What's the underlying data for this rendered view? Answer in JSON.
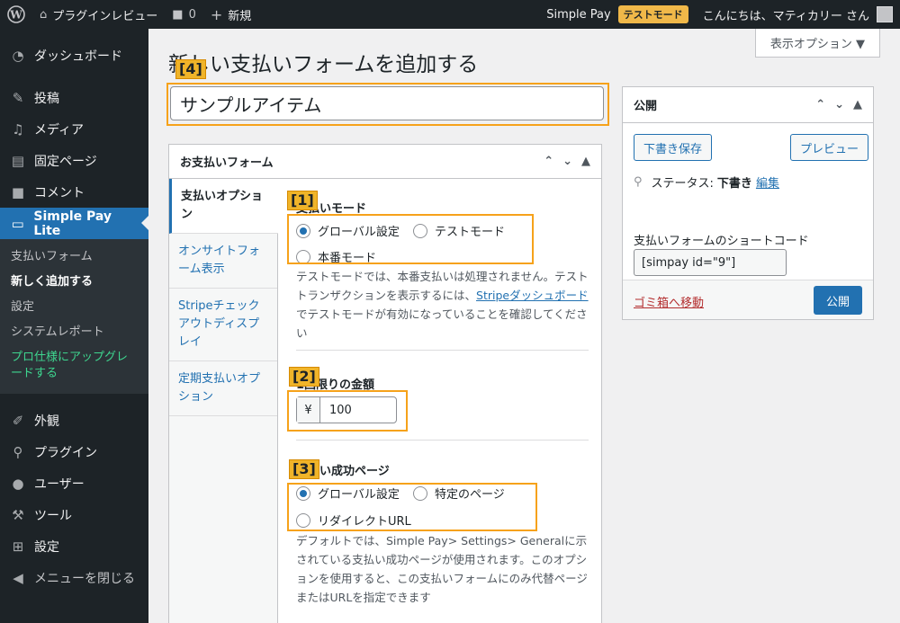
{
  "adminbar": {
    "site_name": "プラグインレビュー",
    "comments_count": "0",
    "new_label": "新規",
    "plugin_name": "Simple Pay",
    "test_badge": "テストモード",
    "greeting": "こんにちは、マティカリー さん"
  },
  "sidebar": {
    "items": [
      {
        "label": "ダッシュボード",
        "icon": "dashboard-icon"
      },
      {
        "label": "投稿",
        "icon": "pin-icon"
      },
      {
        "label": "メディア",
        "icon": "media-icon"
      },
      {
        "label": "固定ページ",
        "icon": "page-icon"
      },
      {
        "label": "コメント",
        "icon": "comment-icon"
      },
      {
        "label": "Simple Pay Lite",
        "icon": "card-icon"
      }
    ],
    "submenu": [
      "支払いフォーム",
      "新しく追加する",
      "設定",
      "システムレポート",
      "プロ仕様にアップグレードする"
    ],
    "items2": [
      {
        "label": "外観",
        "icon": "brush-icon"
      },
      {
        "label": "プラグイン",
        "icon": "plugin-icon"
      },
      {
        "label": "ユーザー",
        "icon": "user-icon"
      },
      {
        "label": "ツール",
        "icon": "wrench-icon"
      },
      {
        "label": "設定",
        "icon": "settings-icon"
      },
      {
        "label": "メニューを閉じる",
        "icon": "collapse-icon"
      }
    ]
  },
  "main": {
    "screen_options": "表示オプション ▼",
    "page_title": "新しい支払いフォームを追加する",
    "title_value": "サンプルアイテム",
    "labels": [
      "[4]",
      "[1]",
      "[2]",
      "[3]"
    ]
  },
  "form_box": {
    "title": "お支払いフォーム",
    "tabs": [
      "支払いオプション",
      "オンサイトフォーム表示",
      "Stripeチェックアウトディスプレイ",
      "定期支払いオプション"
    ],
    "payment_mode": {
      "label": "支払いモード",
      "options": [
        "グローバル設定",
        "テストモード",
        "本番モード"
      ],
      "desc_before": "テストモードでは、本番支払いは処理されません。テストトランザクションを表示するには、",
      "desc_link": "Stripeダッシュボード",
      "desc_after": "でテストモードが有効になっていることを確認してください"
    },
    "amount": {
      "label": "1回限りの金額",
      "currency": "¥",
      "value": "100"
    },
    "success_page": {
      "label": "支払い成功ページ",
      "options": [
        "グローバル設定",
        "特定のページ",
        "リダイレクトURL"
      ],
      "desc": "デフォルトでは、Simple Pay> Settings> Generalに示されている支払い成功ページが使用されます。このオプションを使用すると、この支払いフォームにのみ代替ページまたはURLを指定できます"
    }
  },
  "publish": {
    "title": "公開",
    "save_draft": "下書き保存",
    "preview": "プレビュー",
    "status_label": "ステータス:",
    "status_value": "下書き",
    "edit_link": "編集",
    "shortcode_label": "支払いフォームのショートコード",
    "shortcode_value": "[simpay id=\"9\"]",
    "trash": "ゴミ箱へ移動",
    "publish": "公開"
  }
}
